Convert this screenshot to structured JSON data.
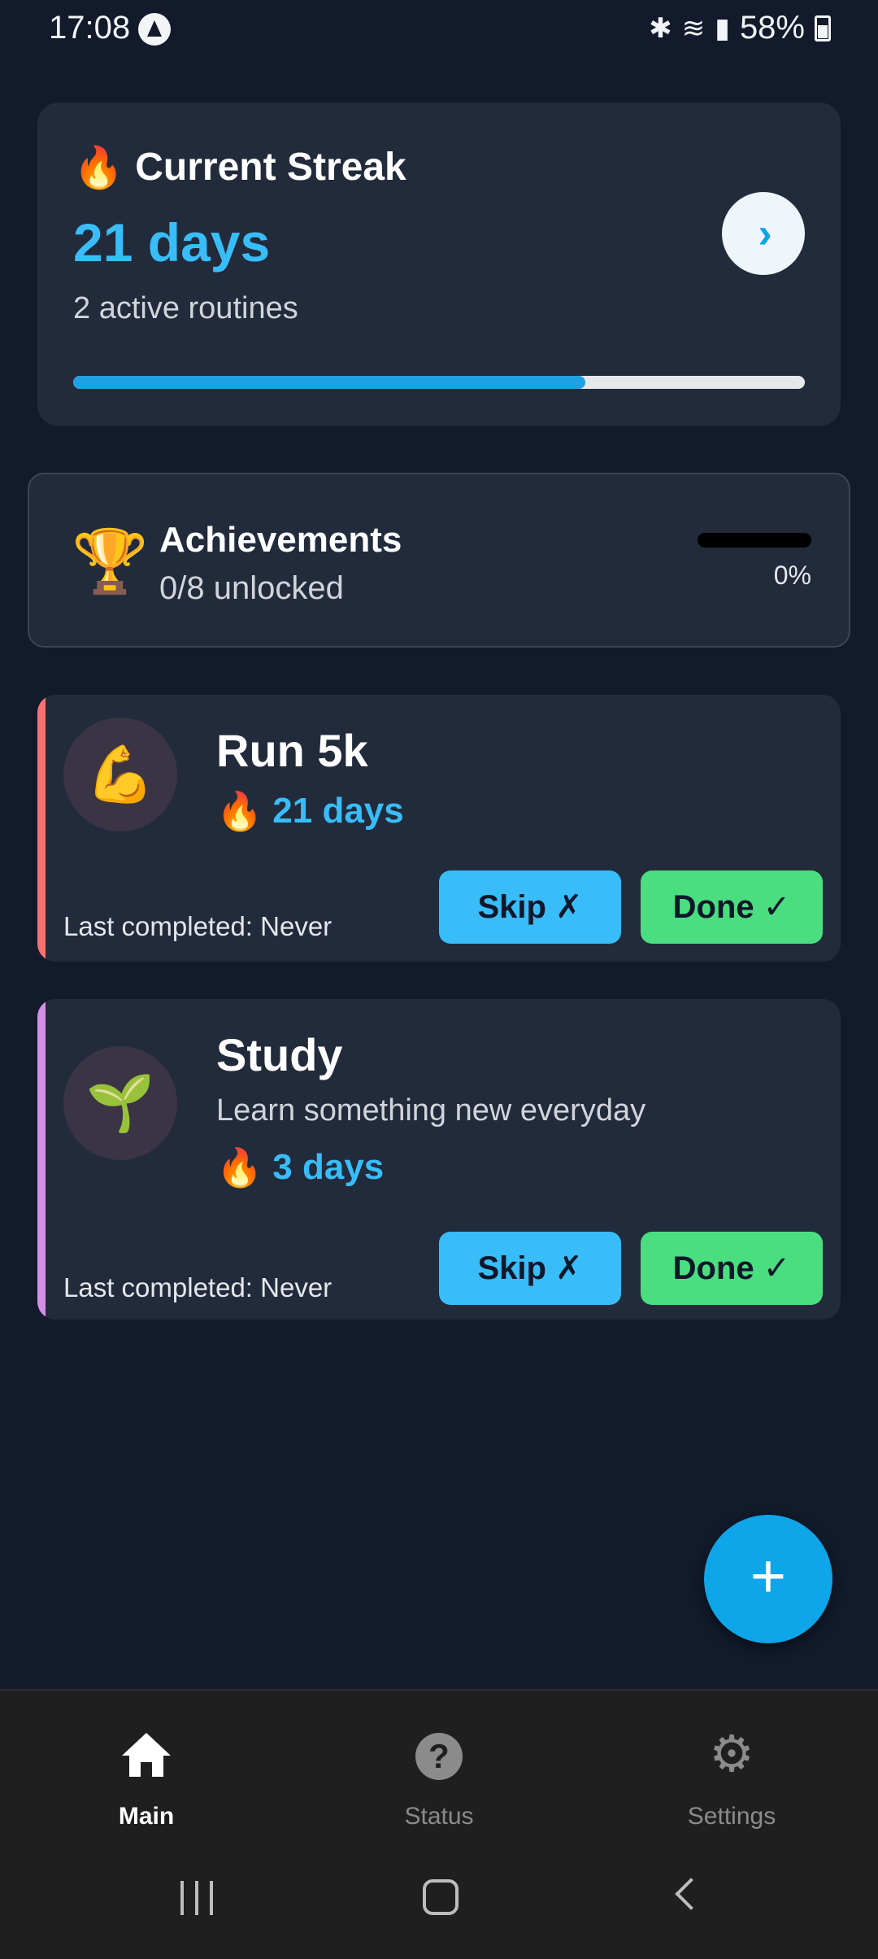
{
  "status_bar": {
    "time": "17:08",
    "battery": "58%",
    "icons": [
      "app-icon",
      "bluetooth-icon",
      "wifi-icon",
      "signal-icon",
      "battery-icon"
    ]
  },
  "streak": {
    "title": "Current Streak",
    "value": "21 days",
    "subtitle": "2 active routines",
    "progress": 0.7
  },
  "achievements": {
    "title": "Achievements",
    "subtitle": "0/8 unlocked",
    "percent": "0%",
    "progress": 0
  },
  "routines": [
    {
      "name": "Run 5k",
      "emoji": "💪",
      "streak": "21 days",
      "last_completed": "Last completed: Never",
      "accent_color": "#f87171",
      "skip_label": "Skip ✗",
      "done_label": "Done ✓"
    },
    {
      "name": "Study",
      "description": "Learn something new everyday",
      "emoji": "🌱",
      "streak": "3 days",
      "last_completed": "Last completed: Never",
      "accent_color": "#d58ee6",
      "skip_label": "Skip ✗",
      "done_label": "Done ✓"
    }
  ],
  "fab": {
    "icon": "plus-icon",
    "label": "+"
  },
  "nav": [
    {
      "label": "Main",
      "icon": "home-icon",
      "active": true
    },
    {
      "label": "Status",
      "icon": "help-icon",
      "active": false
    },
    {
      "label": "Settings",
      "icon": "gear-icon",
      "active": false
    }
  ],
  "colors": {
    "background": "#121a2b",
    "card": "#222b3b",
    "accent_blue": "#38bdf8",
    "done_green": "#4ade80"
  }
}
